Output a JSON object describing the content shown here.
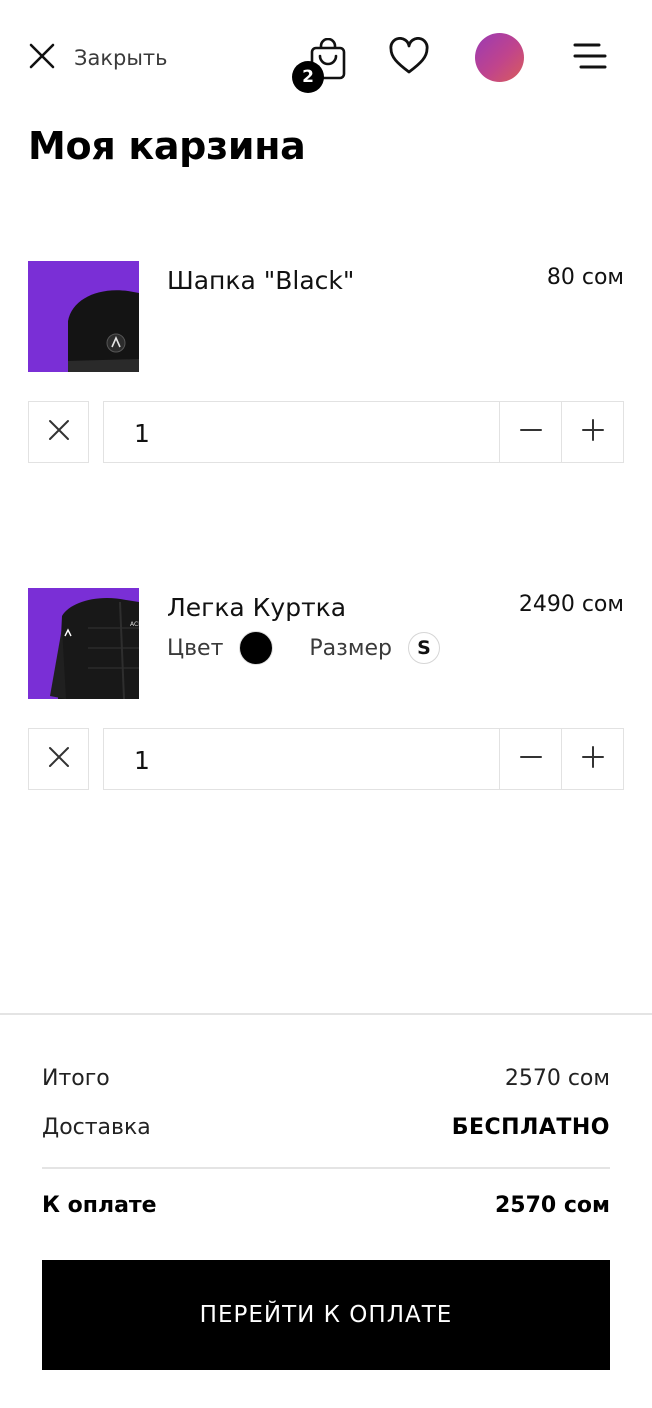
{
  "header": {
    "close_label": "Закрыть",
    "cart_count": "2",
    "avatar_gradient": [
      "#9a3ab4",
      "#d95d5a"
    ]
  },
  "page_title": "Моя карзина",
  "cart": {
    "items": [
      {
        "name": "Шапка \"Black\"",
        "price": "80 сом",
        "quantity": "1",
        "image": "black-beanie-on-purple",
        "thumb_bg": "#7a2fd6"
      },
      {
        "name": "Легка Куртка",
        "price": "2490 сом",
        "color_label": "Цвет",
        "color_value": "#000000",
        "size_label": "Размер",
        "size_value": "S",
        "quantity": "1",
        "image": "black-jacket-on-purple",
        "thumb_bg": "#7a2fd6"
      }
    ]
  },
  "summary": {
    "subtotal_label": "Итого",
    "subtotal_value": "2570 сом",
    "delivery_label": "Доставка",
    "delivery_value": "БЕСПЛАТНО",
    "total_label": "К оплате",
    "total_value": "2570 сом",
    "checkout_label": "ПЕРЕЙТИ К ОПЛАТЕ"
  }
}
